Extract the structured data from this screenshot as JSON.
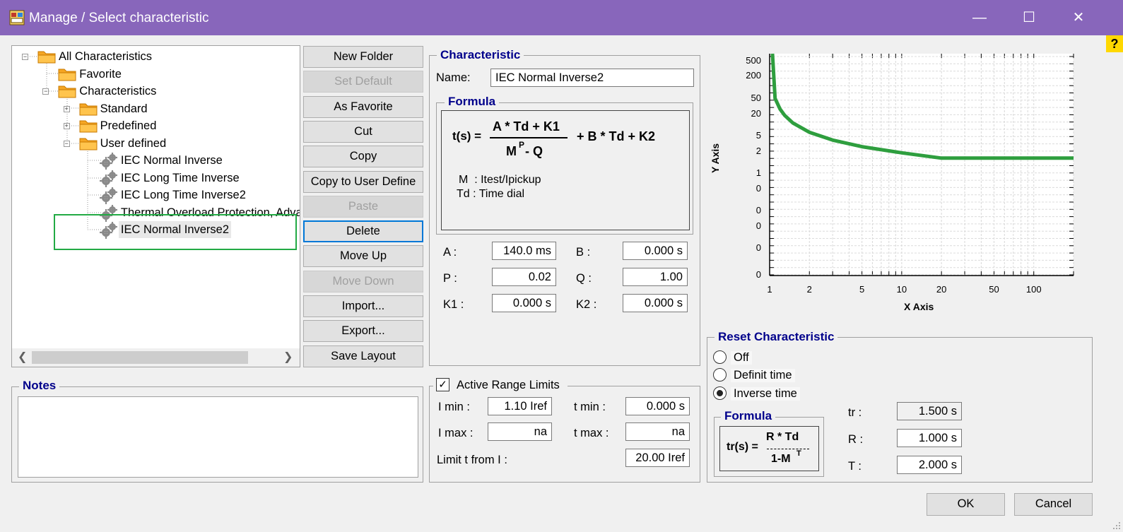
{
  "window": {
    "title": "Manage / Select characteristic",
    "controls": [
      "—",
      "☐",
      "✕"
    ]
  },
  "help_label": "?",
  "tree": [
    {
      "label": "All Characteristics",
      "level": 0,
      "expander": "−",
      "type": "folder"
    },
    {
      "label": "Favorite",
      "level": 1,
      "expander": "",
      "type": "folder"
    },
    {
      "label": "Characteristics",
      "level": 1,
      "expander": "−",
      "type": "folder"
    },
    {
      "label": "Standard",
      "level": 2,
      "expander": "+",
      "type": "folder"
    },
    {
      "label": "Predefined",
      "level": 2,
      "expander": "+",
      "type": "folder"
    },
    {
      "label": "User defined",
      "level": 2,
      "expander": "−",
      "type": "folder"
    },
    {
      "label": "IEC Normal Inverse",
      "level": 3,
      "expander": "",
      "type": "item"
    },
    {
      "label": "IEC Long Time Inverse",
      "level": 3,
      "expander": "",
      "type": "item"
    },
    {
      "label": "IEC Long Time Inverse2",
      "level": 3,
      "expander": "",
      "type": "item"
    },
    {
      "label": "Thermal Overload Protection, Advanced",
      "level": 3,
      "expander": "",
      "type": "item"
    },
    {
      "label": "IEC Normal Inverse2",
      "level": 3,
      "expander": "",
      "type": "item",
      "selected": true
    }
  ],
  "buttons": [
    {
      "label": "New Folder",
      "enabled": true
    },
    {
      "label": "Set Default",
      "enabled": false
    },
    {
      "label": "As Favorite",
      "enabled": true
    },
    {
      "label": "Cut",
      "enabled": true
    },
    {
      "label": "Copy",
      "enabled": true
    },
    {
      "label": "Copy to User Define",
      "enabled": true
    },
    {
      "label": "Paste",
      "enabled": false
    },
    {
      "label": "Delete",
      "enabled": true,
      "focused": true
    },
    {
      "label": "Move Up",
      "enabled": true
    },
    {
      "label": "Move Down",
      "enabled": false
    },
    {
      "label": "Import...",
      "enabled": true
    },
    {
      "label": "Export...",
      "enabled": true
    },
    {
      "label": "Save Layout",
      "enabled": true
    }
  ],
  "characteristic": {
    "title": "Characteristic",
    "name_label": "Name:",
    "name_value": "IEC Normal Inverse2",
    "formula_title": "Formula",
    "formula": {
      "lhs": "t(s) =",
      "numerator": "A * Td + K1",
      "denominator_base": "M",
      "denominator_exp": "P",
      "denominator_rest": "- Q",
      "tail": "+ B * Td + K2",
      "legend_m": "M  : Itest/Ipickup",
      "legend_td": "Td : Time dial"
    },
    "params": [
      {
        "label": "A :",
        "value": "140.0 ms"
      },
      {
        "label": "B :",
        "value": "0.000 s"
      },
      {
        "label": "P :",
        "value": "0.02"
      },
      {
        "label": "Q :",
        "value": "1.00"
      },
      {
        "label": "K1 :",
        "value": "0.000 s"
      },
      {
        "label": "K2 :",
        "value": "0.000 s"
      }
    ]
  },
  "chart": {
    "xlabel": "X Axis",
    "ylabel": "Y Axis",
    "x_ticks": [
      "1",
      "2",
      "5",
      "10",
      "20",
      "50",
      "100"
    ],
    "y_ticks": [
      "500",
      "200",
      "50",
      "20",
      "5",
      "2",
      "1",
      "0",
      "0",
      "0",
      "0",
      "0"
    ],
    "curve_color": "#2e9e3e"
  },
  "chart_data": {
    "type": "line",
    "xlabel": "X Axis",
    "ylabel": "Y Axis",
    "x_scale": "log",
    "y_scale": "log",
    "xlim": [
      1,
      200
    ],
    "grid": true,
    "series": [
      {
        "x": [
          1.05,
          1.1,
          1.2,
          1.3,
          1.5,
          2,
          3,
          5,
          10,
          20,
          50,
          100,
          200
        ],
        "y": [
          1000,
          72.6,
          38.7,
          26.9,
          17.2,
          10.0,
          6.3,
          4.3,
          3.0,
          2.2,
          2.2,
          2.2,
          2.2
        ]
      }
    ]
  },
  "notes": {
    "title": "Notes",
    "text": ""
  },
  "range_limits": {
    "checkbox_label": "Active Range Limits",
    "checked": true,
    "i_min_label": "I min :",
    "i_min": "1.10 Iref",
    "t_min_label": "t min :",
    "t_min": "0.000 s",
    "i_max_label": "I max :",
    "i_max": "na",
    "t_max_label": "t max :",
    "t_max": "na",
    "limit_t_label": "Limit t from I :",
    "limit_t": "20.00 Iref"
  },
  "reset": {
    "title": "Reset Characteristic",
    "options": [
      {
        "label": "Off",
        "checked": false
      },
      {
        "label": "Definit time",
        "checked": false
      },
      {
        "label": "Inverse time",
        "checked": true
      }
    ],
    "formula_title": "Formula",
    "formula": {
      "lhs": "tr(s) =",
      "numerator": "R * Td",
      "denominator_base": "1-M",
      "denominator_exp": "T"
    },
    "params": [
      {
        "label": "tr :",
        "value": "1.500 s"
      },
      {
        "label": "R :",
        "value": "1.000 s"
      },
      {
        "label": "T :",
        "value": "2.000 s"
      }
    ]
  },
  "footer": {
    "ok": "OK",
    "cancel": "Cancel"
  }
}
